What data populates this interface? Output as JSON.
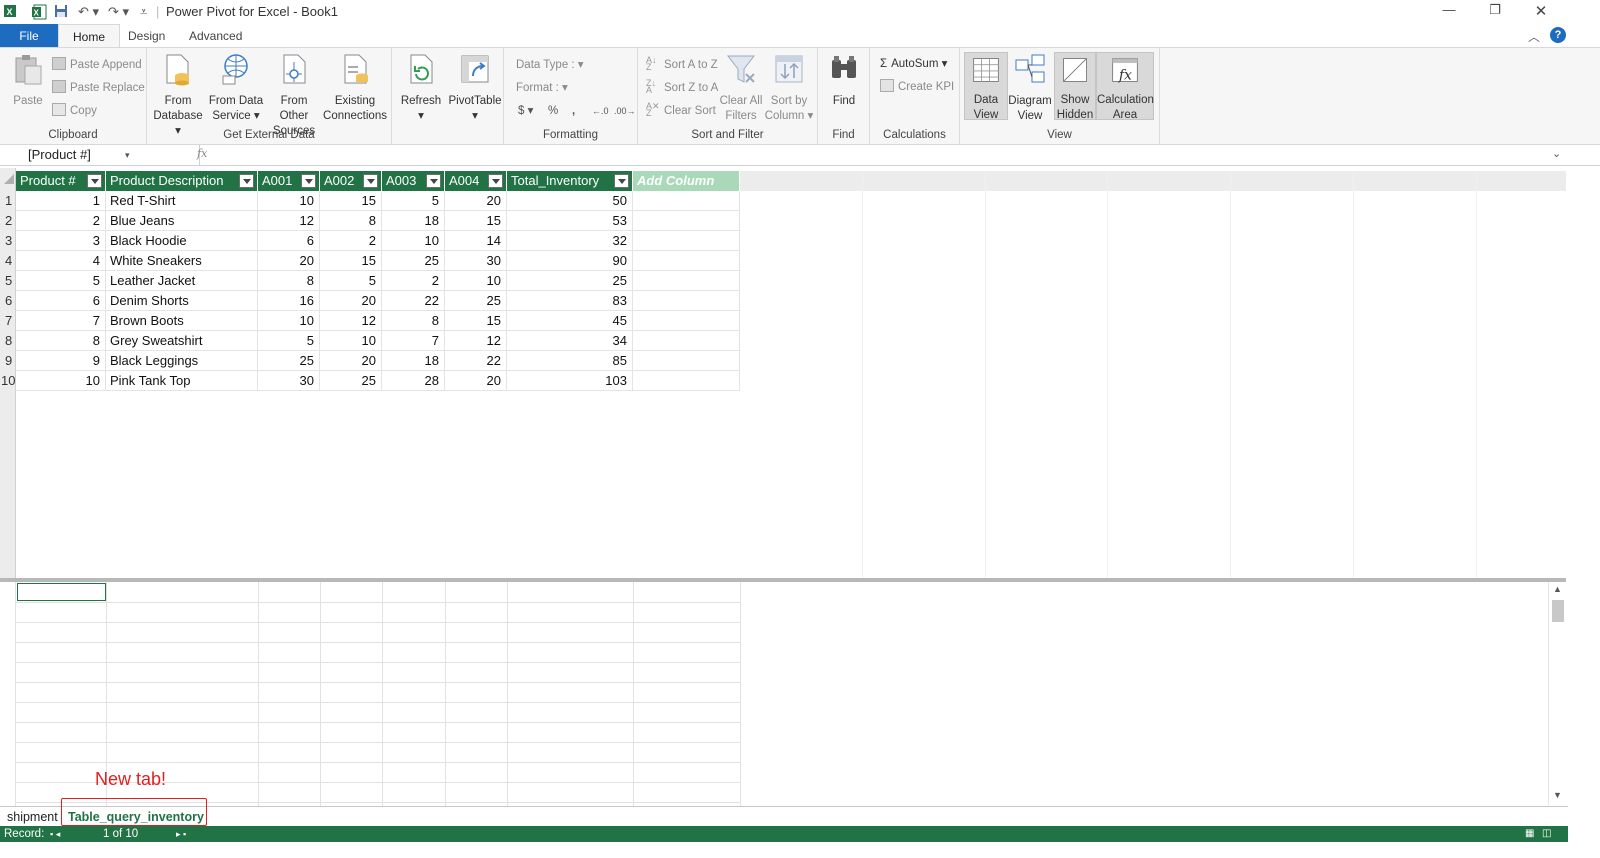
{
  "window": {
    "title": "Power Pivot for Excel - Book1",
    "controls": [
      "minimize",
      "restore",
      "close"
    ]
  },
  "ribbon_tabs": [
    {
      "label": "File"
    },
    {
      "label": "Home",
      "active": true
    },
    {
      "label": "Design"
    },
    {
      "label": "Advanced"
    }
  ],
  "ribbon": {
    "clipboard": {
      "label": "Clipboard",
      "paste": "Paste",
      "paste_append": "Paste Append",
      "paste_replace": "Paste Replace",
      "copy": "Copy"
    },
    "external": {
      "label": "Get External Data",
      "from_database": [
        "From",
        "Database"
      ],
      "from_data_service": [
        "From Data",
        "Service"
      ],
      "from_other_sources": [
        "From Other",
        "Sources"
      ],
      "existing_connections": [
        "Existing",
        "Connections"
      ]
    },
    "refresh": "Refresh",
    "pivottable": "PivotTable",
    "formatting": {
      "label": "Formatting",
      "data_type": "Data Type :",
      "format": "Format :",
      "currency": "$",
      "percent": "%",
      "comma": ","
    },
    "sort_filter": {
      "label": "Sort and Filter",
      "sort_az": "Sort A to Z",
      "sort_za": "Sort Z to A",
      "clear_sort": "Clear Sort",
      "clear_all_filters": [
        "Clear All",
        "Filters"
      ],
      "sort_by_column": [
        "Sort by",
        "Column"
      ]
    },
    "find": {
      "label": "Find",
      "button": "Find"
    },
    "calculations": {
      "label": "Calculations",
      "autosum": "AutoSum",
      "create_kpi": "Create KPI"
    },
    "view": {
      "label": "View",
      "data_view": [
        "Data",
        "View"
      ],
      "diagram_view": [
        "Diagram",
        "View"
      ],
      "show_hidden": [
        "Show",
        "Hidden"
      ],
      "calculation_area": [
        "Calculation",
        "Area"
      ]
    }
  },
  "formula_bar": {
    "name_box": "[Product #]",
    "fx": "fx",
    "formula": ""
  },
  "table": {
    "columns": [
      "Product #",
      "Product Description",
      "A001",
      "A002",
      "A003",
      "A004",
      "Total_Inventory"
    ],
    "add_column": "Add Column",
    "rows": [
      [
        "1",
        "1",
        "Red T-Shirt",
        "10",
        "15",
        "5",
        "20",
        "50"
      ],
      [
        "2",
        "2",
        "Blue Jeans",
        "12",
        "8",
        "18",
        "15",
        "53"
      ],
      [
        "3",
        "3",
        "Black Hoodie",
        "6",
        "2",
        "10",
        "14",
        "32"
      ],
      [
        "4",
        "4",
        "White Sneakers",
        "20",
        "15",
        "25",
        "30",
        "90"
      ],
      [
        "5",
        "5",
        "Leather Jacket",
        "8",
        "5",
        "2",
        "10",
        "25"
      ],
      [
        "6",
        "6",
        "Denim Shorts",
        "16",
        "20",
        "22",
        "25",
        "83"
      ],
      [
        "7",
        "7",
        "Brown Boots",
        "10",
        "12",
        "8",
        "15",
        "45"
      ],
      [
        "8",
        "8",
        "Grey Sweatshirt",
        "5",
        "10",
        "7",
        "12",
        "34"
      ],
      [
        "9",
        "9",
        "Black Leggings",
        "25",
        "20",
        "18",
        "22",
        "85"
      ],
      [
        "10",
        "10",
        "Pink Tank Top",
        "30",
        "25",
        "28",
        "20",
        "103"
      ]
    ]
  },
  "annotation": "New tab!",
  "sheet_tabs": [
    {
      "label": "shipment",
      "active": false
    },
    {
      "label": "Table_query_inventory",
      "active": true
    }
  ],
  "status_bar": {
    "record_label": "Record:",
    "record_position": "1 of 10"
  },
  "colors": {
    "accent": "#217346",
    "file_tab": "#1e6cc0",
    "annotation": "#e02020",
    "add_column": "#a9d9b8"
  }
}
